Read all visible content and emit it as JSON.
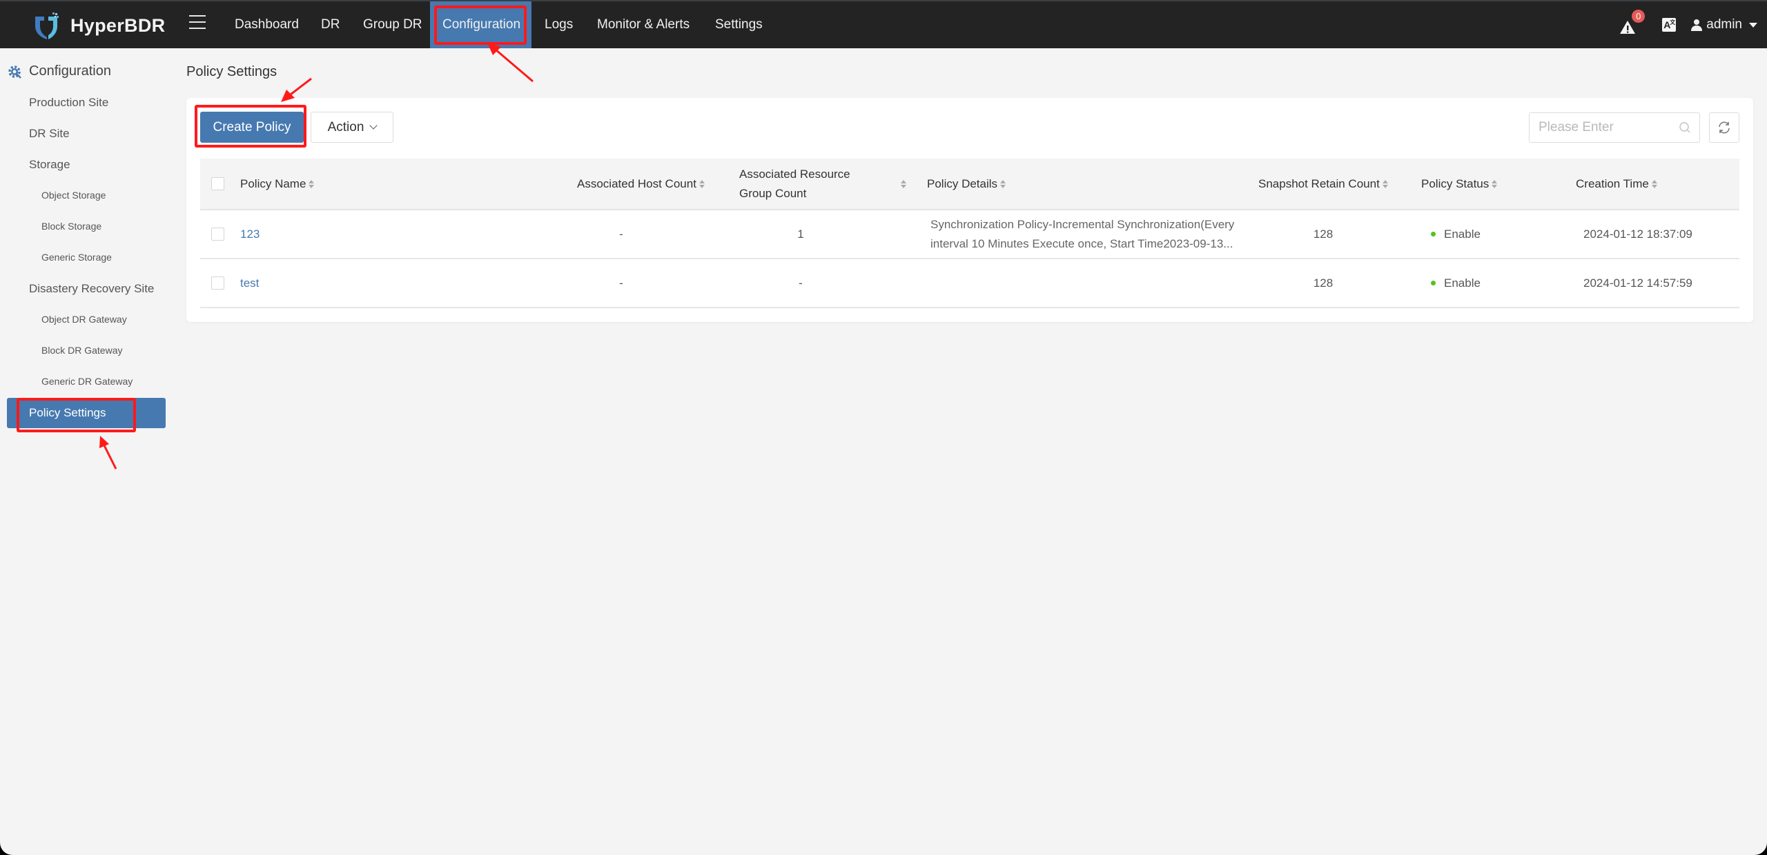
{
  "app": {
    "name": "HyperBDR",
    "colors": {
      "nav_bg": "#232323",
      "accent": "#4679b0",
      "status_enabled": "#52c41a",
      "badge": "#e65a5a",
      "annotation": "#ff1a1a"
    }
  },
  "topnav": {
    "menu_icon": "hamburger-icon",
    "tabs": [
      {
        "label": "Dashboard",
        "active": false
      },
      {
        "label": "DR",
        "active": false
      },
      {
        "label": "Group DR",
        "active": false
      },
      {
        "label": "Configuration",
        "active": true
      },
      {
        "label": "Logs",
        "active": false
      },
      {
        "label": "Monitor & Alerts",
        "active": false
      },
      {
        "label": "Settings",
        "active": false
      }
    ],
    "alert_count": "0",
    "language_icon": "A",
    "user": "admin"
  },
  "sidebar": {
    "header": "Configuration",
    "items": [
      {
        "label": "Production Site",
        "level": 1
      },
      {
        "label": "DR Site",
        "level": 1
      },
      {
        "label": "Storage",
        "level": 1
      },
      {
        "label": "Object Storage",
        "level": 2
      },
      {
        "label": "Block Storage",
        "level": 2
      },
      {
        "label": "Generic Storage",
        "level": 2
      },
      {
        "label": "Disastery Recovery Site",
        "level": 1
      },
      {
        "label": "Object DR Gateway",
        "level": 2
      },
      {
        "label": "Block DR Gateway",
        "level": 2
      },
      {
        "label": "Generic DR Gateway",
        "level": 2
      },
      {
        "label": "Policy Settings",
        "level": 1,
        "active": true
      }
    ]
  },
  "main": {
    "title": "Policy Settings",
    "toolbar": {
      "create_label": "Create Policy",
      "action_label": "Action",
      "search_placeholder": "Please Enter",
      "search_value": ""
    },
    "table": {
      "columns": [
        "Policy Name",
        "Associated Host Count",
        "Associated Resource Group Count",
        "Policy Details",
        "Snapshot Retain Count",
        "Policy Status",
        "Creation Time"
      ],
      "rows": [
        {
          "name": "123",
          "host_count": "-",
          "resource_group_count": "1",
          "details_line1": "Synchronization Policy-Incremental Synchronization(Every",
          "details_line2": "interval 10 Minutes Execute once, Start Time2023-09-13...",
          "snapshot_retain": "128",
          "status": "Enable",
          "created": "2024-01-12 18:37:09"
        },
        {
          "name": "test",
          "host_count": "-",
          "resource_group_count": "-",
          "details_line1": "",
          "details_line2": "",
          "snapshot_retain": "128",
          "status": "Enable",
          "created": "2024-01-12 14:57:59"
        }
      ]
    }
  }
}
